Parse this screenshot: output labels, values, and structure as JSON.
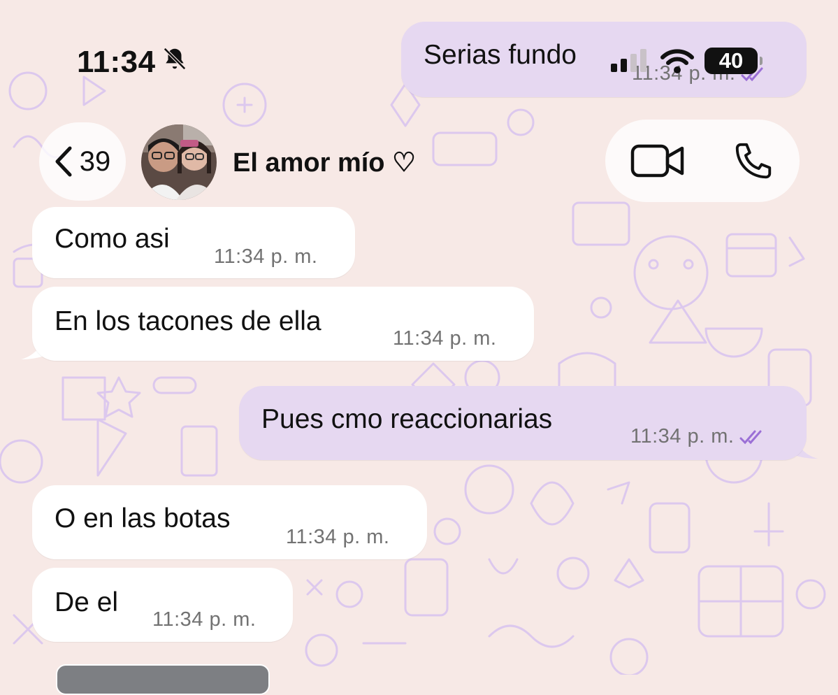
{
  "status_bar": {
    "time": "11:34",
    "battery": "40"
  },
  "header": {
    "back_count": "39",
    "contact_name": "El amor mío ♡"
  },
  "messages": [
    {
      "direction": "outgoing",
      "text": "Serias fundo",
      "time": "11:34 p. m.",
      "status": "read"
    },
    {
      "direction": "incoming",
      "text": "Como asi",
      "time": "11:34 p. m."
    },
    {
      "direction": "incoming",
      "text": "En los tacones de ella",
      "time": "11:34 p. m."
    },
    {
      "direction": "outgoing",
      "text": "Pues cmo reaccionarias",
      "time": "11:34 p. m.",
      "status": "read"
    },
    {
      "direction": "incoming",
      "text": "O en las botas",
      "time": "11:34 p. m."
    },
    {
      "direction": "incoming",
      "text": "De el",
      "time": "11:34 p. m."
    }
  ],
  "colors": {
    "wallpaper": "#f7e9e6",
    "incoming_bubble": "#ffffff",
    "outgoing_bubble": "#e6d8f1",
    "read_ticks": "#9b6fd6",
    "doodle": "#dcc8ee"
  },
  "icons": [
    "bell-slash-icon",
    "signal-icon",
    "wifi-icon",
    "battery-icon",
    "chevron-left-icon",
    "video-call-icon",
    "phone-icon",
    "double-check-icon"
  ]
}
